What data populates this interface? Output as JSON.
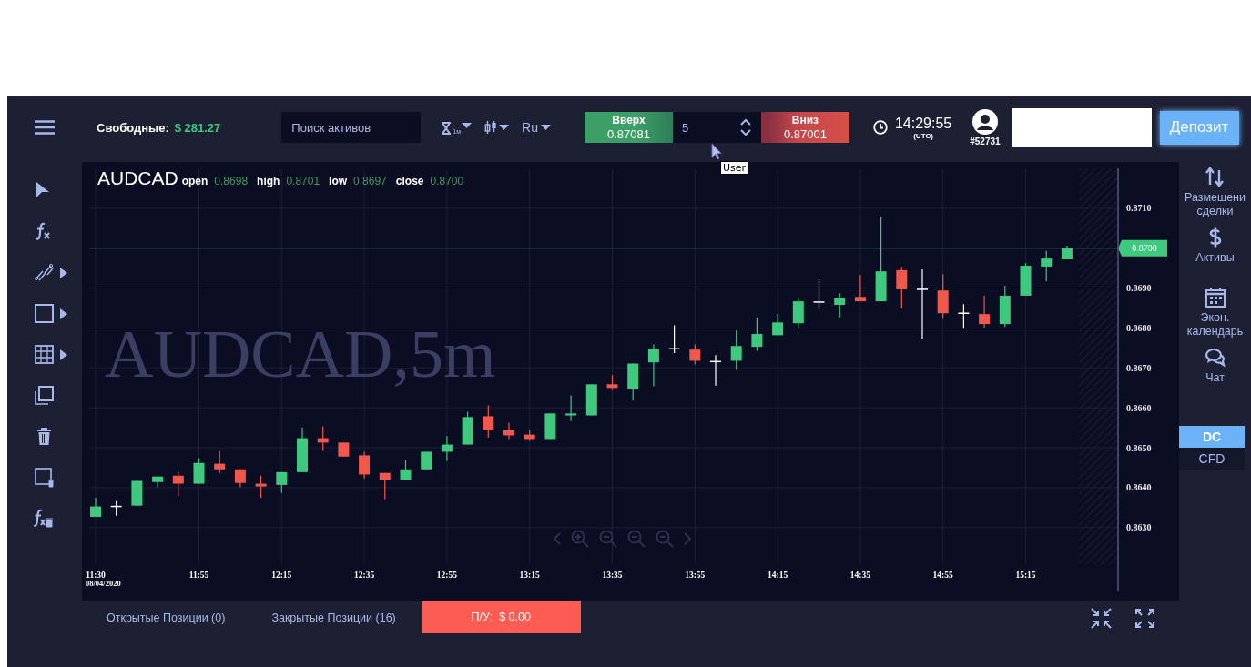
{
  "header": {
    "balance_label": "Свободные:",
    "balance": "$ 281.27",
    "search": {
      "placeholder": "Поиск активов"
    },
    "timeframe": "1м",
    "language": "Ru",
    "up_button": {
      "label": "Вверх",
      "price": "0.87081"
    },
    "amount": {
      "value": "5"
    },
    "down_button": {
      "label": "Вниз",
      "price": "0.87001"
    },
    "time": "14:29:55",
    "timezone": "(UTC)",
    "account": "#52731",
    "deposit_button": "Депозит"
  },
  "tooltip": "User",
  "left_toolbar": [
    {
      "kind": "pointer",
      "submenu": false
    },
    {
      "kind": "indicator",
      "submenu": false
    },
    {
      "kind": "line",
      "submenu": true
    },
    {
      "kind": "rectangle",
      "submenu": true
    },
    {
      "kind": "grid",
      "submenu": true
    },
    {
      "kind": "copy",
      "submenu": false
    },
    {
      "kind": "delete",
      "submenu": false
    },
    {
      "kind": "delete-drawing",
      "submenu": false
    },
    {
      "kind": "delete-indicator",
      "submenu": false
    }
  ],
  "chart": {
    "symbol": "AUDCAD",
    "ohlc": [
      {
        "label": "open",
        "value": "0.8698"
      },
      {
        "label": "high",
        "value": "0.8701"
      },
      {
        "label": "low",
        "value": "0.8697"
      },
      {
        "label": "close",
        "value": "0.8700"
      }
    ],
    "watermark": "AUDCAD,5m",
    "date_label": "08/04/2020",
    "chart_data": {
      "type": "candlestick",
      "grid": true,
      "categories": [
        "11:30",
        null,
        null,
        null,
        null,
        "11:55",
        null,
        null,
        null,
        "12:15",
        null,
        null,
        null,
        "12:35",
        null,
        null,
        null,
        "12:55",
        null,
        null,
        null,
        "13:15",
        null,
        null,
        null,
        "13:35",
        null,
        null,
        null,
        "13:55",
        null,
        null,
        null,
        "14:15",
        null,
        null,
        null,
        "14:35",
        null,
        null,
        null,
        "14:55",
        null,
        null,
        null,
        "15:15",
        null,
        null
      ],
      "ylim": [
        0.8614,
        0.872
      ],
      "ohlc": [
        [
          0.86327,
          0.86375,
          0.86327,
          0.86353
        ],
        [
          0.86353,
          0.86366,
          0.8633,
          0.86353
        ],
        [
          0.86355,
          0.86417,
          0.86355,
          0.86417
        ],
        [
          0.86414,
          0.86428,
          0.86401,
          0.86428
        ],
        [
          0.8643,
          0.86439,
          0.86378,
          0.8641
        ],
        [
          0.8641,
          0.86474,
          0.8641,
          0.86462
        ],
        [
          0.8646,
          0.86492,
          0.86435,
          0.86446
        ],
        [
          0.86446,
          0.86446,
          0.86401,
          0.86412
        ],
        [
          0.8641,
          0.8643,
          0.86375,
          0.86403
        ],
        [
          0.86407,
          0.86439,
          0.86387,
          0.86439
        ],
        [
          0.86439,
          0.86551,
          0.86439,
          0.86524
        ],
        [
          0.86524,
          0.86554,
          0.86492,
          0.86513
        ],
        [
          0.86513,
          0.86513,
          0.86478,
          0.86478
        ],
        [
          0.86481,
          0.8649,
          0.86423,
          0.86433
        ],
        [
          0.86437,
          0.86437,
          0.86371,
          0.86419
        ],
        [
          0.86419,
          0.86469,
          0.86419,
          0.86446
        ],
        [
          0.86446,
          0.8649,
          0.86446,
          0.8649
        ],
        [
          0.8649,
          0.86529,
          0.86467,
          0.86508
        ],
        [
          0.86508,
          0.8659,
          0.86508,
          0.86577
        ],
        [
          0.86579,
          0.86606,
          0.86526,
          0.86545
        ],
        [
          0.86545,
          0.86563,
          0.86522,
          0.86531
        ],
        [
          0.86533,
          0.86545,
          0.86517,
          0.86522
        ],
        [
          0.86522,
          0.86586,
          0.86522,
          0.86586
        ],
        [
          0.86581,
          0.86631,
          0.86567,
          0.86586
        ],
        [
          0.86581,
          0.86659,
          0.86581,
          0.86659
        ],
        [
          0.86659,
          0.86682,
          0.86645,
          0.8665
        ],
        [
          0.86647,
          0.86711,
          0.86618,
          0.86711
        ],
        [
          0.86714,
          0.86759,
          0.86654,
          0.86748
        ],
        [
          0.86748,
          0.86807,
          0.86737,
          0.86748
        ],
        [
          0.86746,
          0.86759,
          0.86709,
          0.86718
        ],
        [
          0.86716,
          0.86732,
          0.86656,
          0.86716
        ],
        [
          0.86718,
          0.86794,
          0.86695,
          0.86755
        ],
        [
          0.86753,
          0.86826,
          0.86743,
          0.86785
        ],
        [
          0.86782,
          0.86835,
          0.86782,
          0.86814
        ],
        [
          0.86812,
          0.86874,
          0.86798,
          0.86867
        ],
        [
          0.86865,
          0.86922,
          0.86846,
          0.86865
        ],
        [
          0.86858,
          0.86887,
          0.86826,
          0.86876
        ],
        [
          0.86878,
          0.86933,
          0.86867,
          0.86867
        ],
        [
          0.86867,
          0.87079,
          0.86867,
          0.86942
        ],
        [
          0.86945,
          0.86954,
          0.86849,
          0.86897
        ],
        [
          0.86897,
          0.86947,
          0.86773,
          0.86897
        ],
        [
          0.86894,
          0.86935,
          0.86823,
          0.86837
        ],
        [
          0.86837,
          0.8686,
          0.86798,
          0.86837
        ],
        [
          0.86835,
          0.86881,
          0.86801,
          0.8681
        ],
        [
          0.8681,
          0.86906,
          0.86803,
          0.86881
        ],
        [
          0.86881,
          0.86963,
          0.86881,
          0.86956
        ],
        [
          0.86954,
          0.86993,
          0.86917,
          0.86974
        ],
        [
          0.86972,
          0.87006,
          0.86972,
          0.87
        ]
      ],
      "yticks": [
        {
          "value": 0.863,
          "label": "0.8630"
        },
        {
          "value": 0.864,
          "label": "0.8640"
        },
        {
          "value": 0.865,
          "label": "0.8650"
        },
        {
          "value": 0.866,
          "label": "0.8660"
        },
        {
          "value": 0.867,
          "label": "0.8670"
        },
        {
          "value": 0.868,
          "label": "0.8680"
        },
        {
          "value": 0.869,
          "label": "0.8690"
        },
        {
          "value": 0.871,
          "label": "0.8710"
        }
      ],
      "ref_lines": [
        {
          "axis": "y",
          "value": 0.87,
          "label": "0.8700"
        }
      ]
    }
  },
  "right_sidebar": {
    "items": [
      {
        "kind": "trade",
        "label": "Размещени сделки"
      },
      {
        "kind": "assets",
        "label": "Активы"
      },
      {
        "kind": "calendar",
        "label": "Экон. календарь"
      },
      {
        "kind": "chat",
        "label": "Чат"
      }
    ],
    "tabs": [
      {
        "label": "DC",
        "selected": true
      },
      {
        "label": "CFD",
        "selected": false
      }
    ]
  },
  "footer": {
    "tabs": [
      {
        "label": "Открытые Позиции (0)"
      },
      {
        "label": "Закрытые Позиции (16)"
      }
    ],
    "pnl_label": "П/У:",
    "pnl_value": "$ 0.00"
  }
}
